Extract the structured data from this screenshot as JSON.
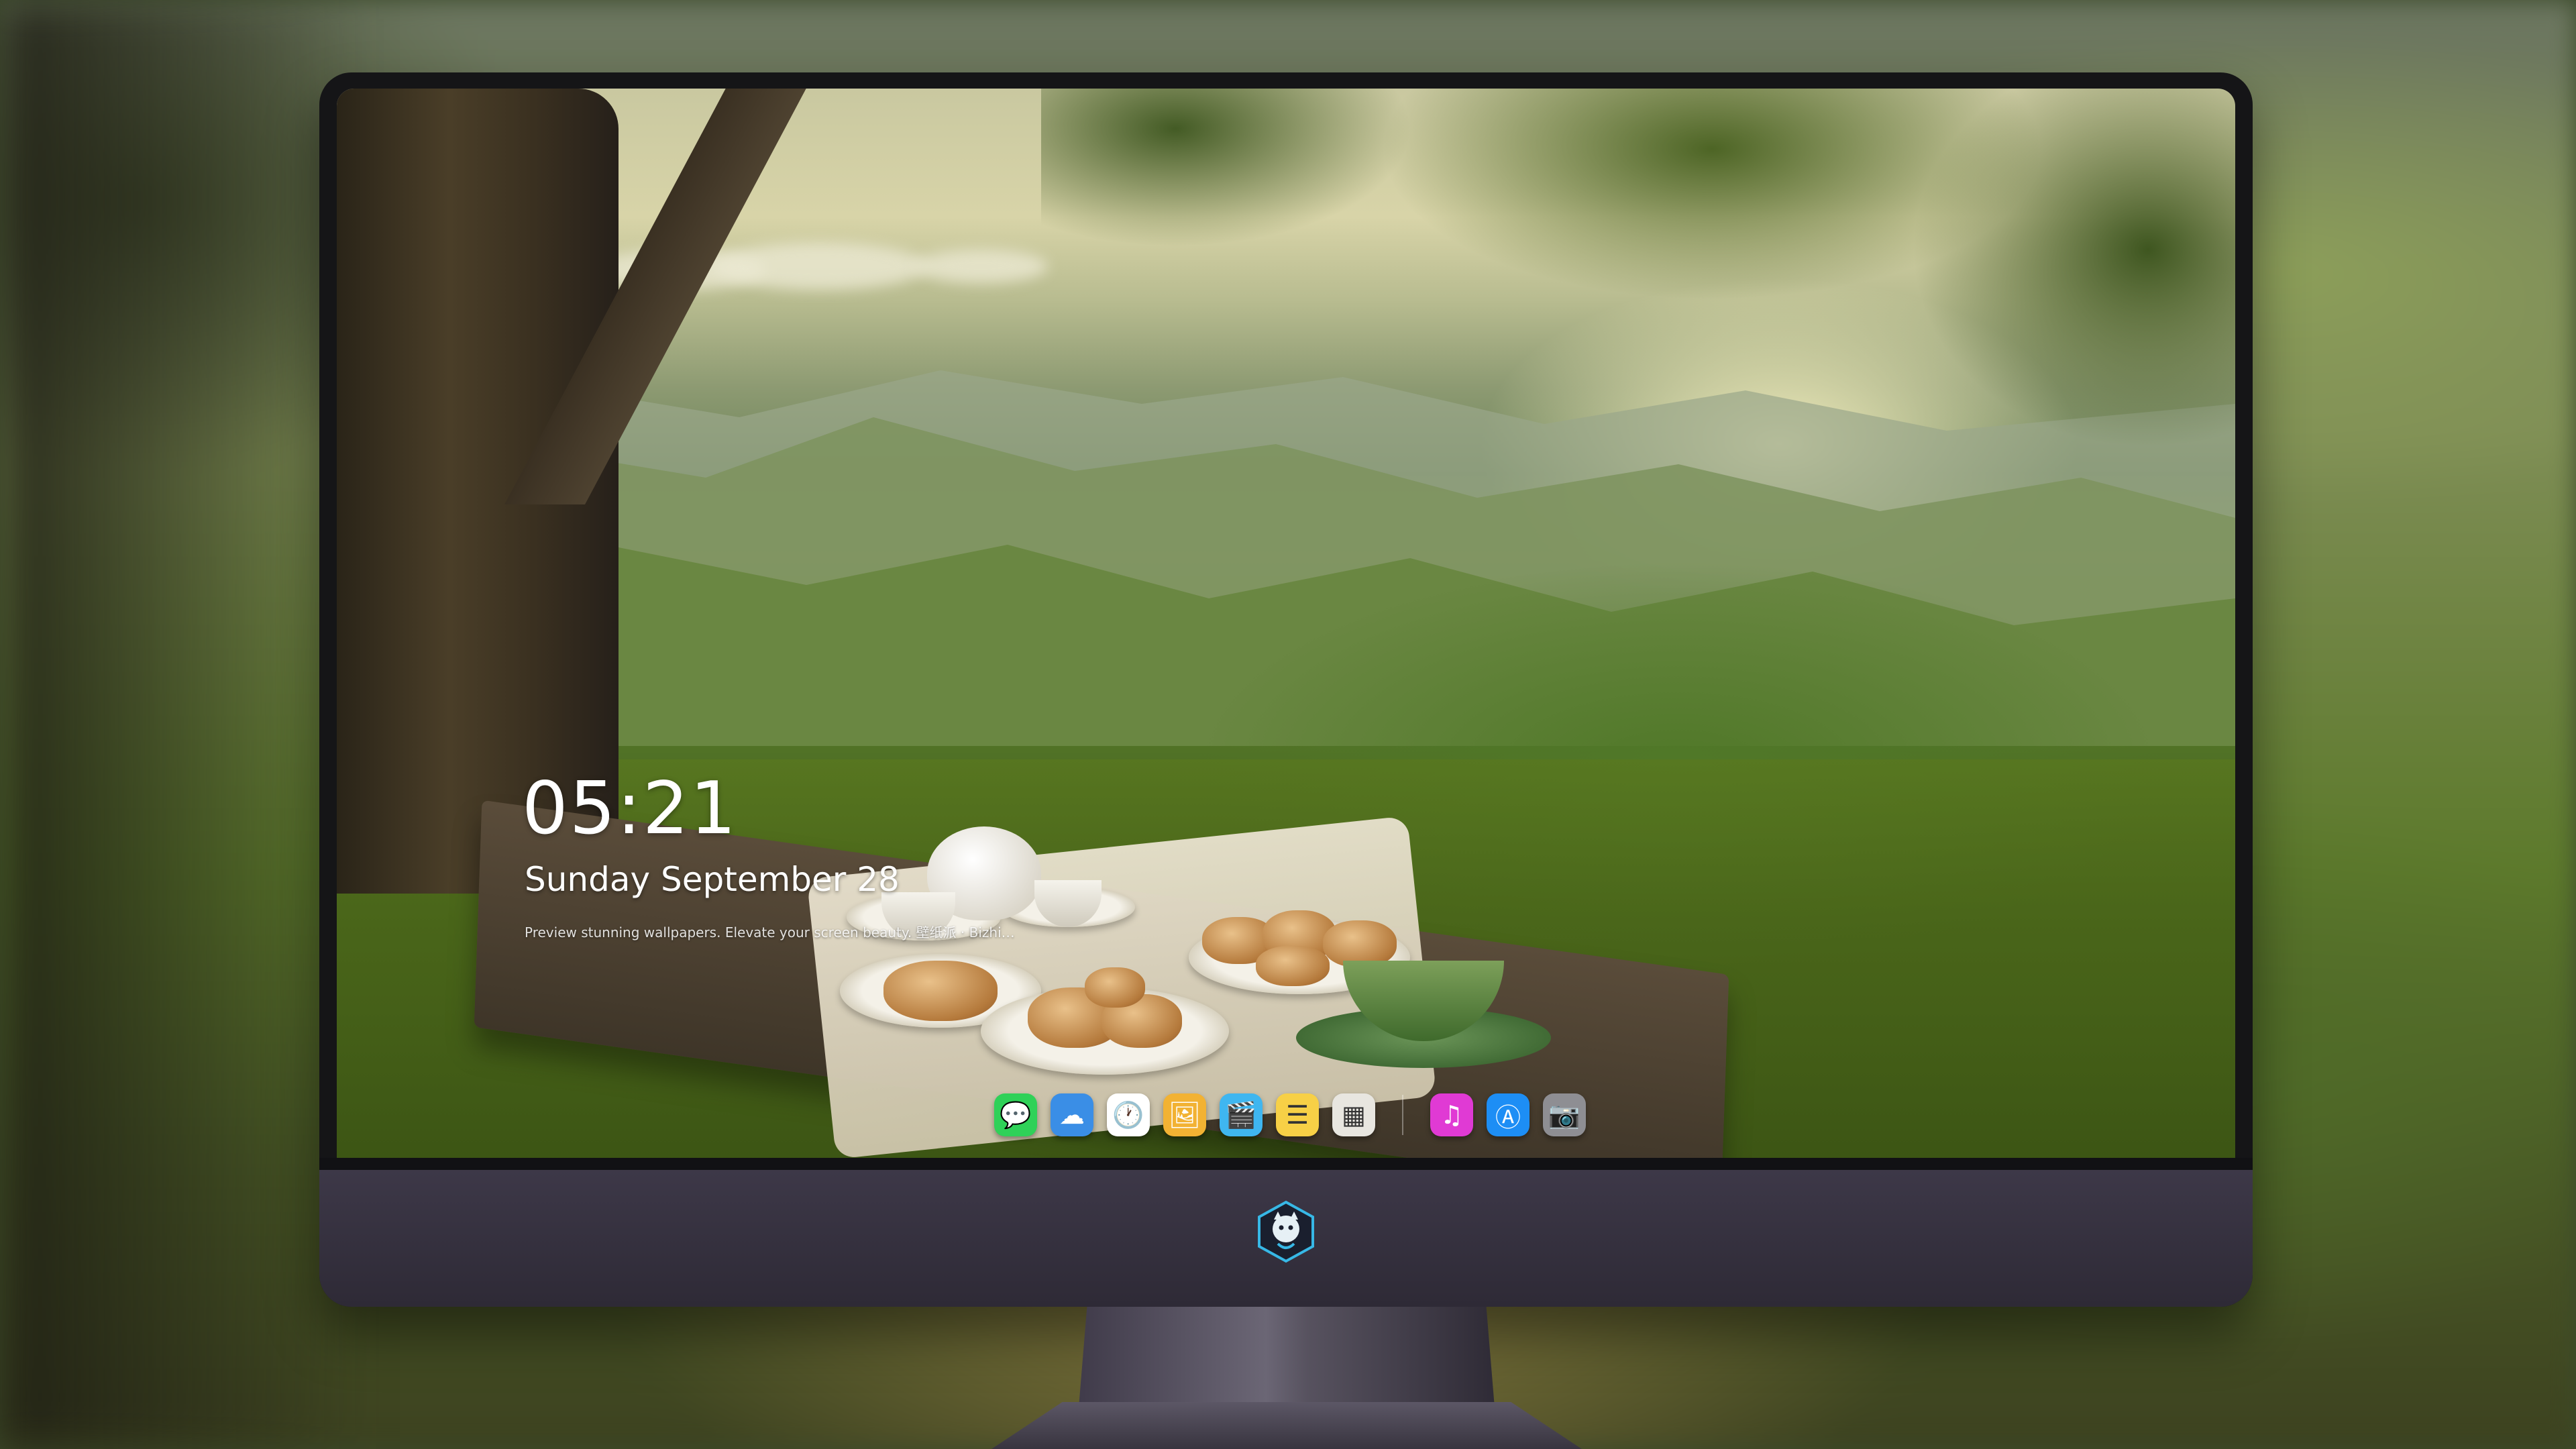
{
  "lockscreen": {
    "time": "05:21",
    "date": "Sunday September  28",
    "tagline": "Preview stunning wallpapers. Elevate your screen beauty. 壁纸派 · Bizhi…"
  },
  "dock": {
    "items": [
      {
        "name": "messages-icon",
        "glyph": "💬",
        "color": "#2fd158"
      },
      {
        "name": "weather-icon",
        "glyph": "☁",
        "color": "#3a8ee6"
      },
      {
        "name": "clock-icon",
        "glyph": "🕐",
        "color": "#ffffff"
      },
      {
        "name": "preview-icon",
        "glyph": "🖼",
        "color": "#f2b233"
      },
      {
        "name": "clips-icon",
        "glyph": "🎬",
        "color": "#3fb6f0"
      },
      {
        "name": "notes-icon",
        "glyph": "☰",
        "color": "#f7d046"
      },
      {
        "name": "photo-grid-icon",
        "glyph": "▦",
        "color": "#e8e6e0"
      },
      {
        "name": "music-icon",
        "glyph": "♫",
        "color": "#e03ad4"
      },
      {
        "name": "app-store-icon",
        "glyph": "Ⓐ",
        "color": "#1d8ef5"
      },
      {
        "name": "camera-icon",
        "glyph": "📷",
        "color": "#8e8e93"
      }
    ]
  },
  "colors": {
    "bezel": "#151517",
    "chin": "#3d3848",
    "stand": "#57525f"
  }
}
